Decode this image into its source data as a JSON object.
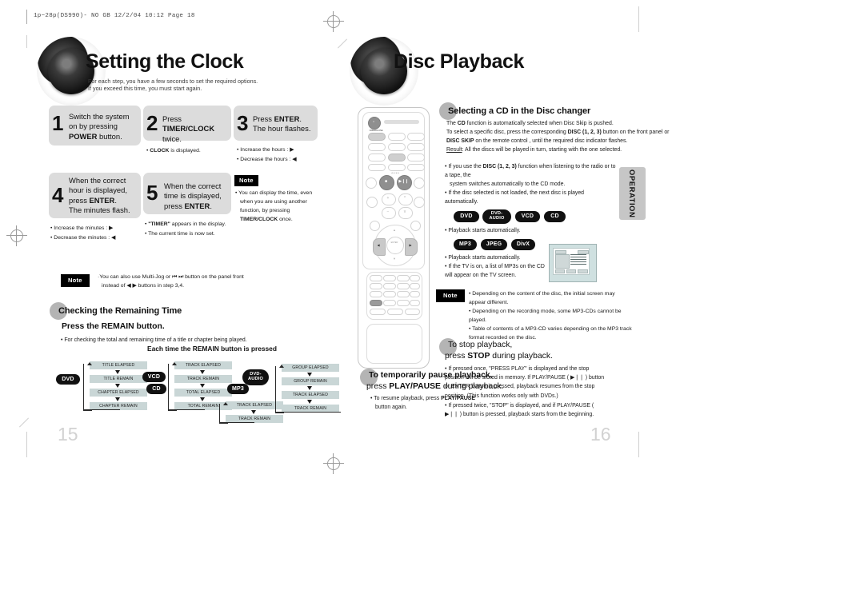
{
  "file_stamp": "1p~28p(DS990)- NO GB  12/2/04 10:12  Page 18",
  "left_page": {
    "chapter_title": "Setting the Clock",
    "chapter_sub_line1": "For each step, you have a few seconds to set the required options.",
    "chapter_sub_line2": "If you exceed this time, you must start again.",
    "steps": [
      {
        "num": "1",
        "line1": "Switch the system",
        "line2": "on by pressing",
        "line3_bold": "POWER",
        "line3_rest": " button.",
        "bullets": []
      },
      {
        "num": "2",
        "line1_pre": "Press ",
        "line1_bold": "TIMER/CLOCK",
        "line2": "twice.",
        "bullets": [
          "CLOCK is displayed."
        ]
      },
      {
        "num": "3",
        "line1_pre": "Press ",
        "line1_bold": "ENTER",
        "line1_post": ".",
        "line2": "The hour flashes.",
        "bullets": [
          "Increase the hours :  ▶",
          "Decrease the hours :  ◀"
        ]
      },
      {
        "num": "4",
        "line1": "When the correct",
        "line2": "hour is displayed,",
        "line3_pre": "press ",
        "line3_bold": "ENTER",
        "line3_post": ".",
        "line4": "The minutes flash.",
        "bullets": [
          "Increase the minutes :  ▶",
          "Decrease the minutes :  ◀"
        ]
      },
      {
        "num": "5",
        "line1": "When the correct",
        "line2": "time is displayed,",
        "line3_pre": "press ",
        "line3_bold": "ENTER",
        "line3_post": ".",
        "bullets": [
          "\"TIMER\" appears in the display.",
          "The current time is now set."
        ]
      }
    ],
    "step_note": {
      "label": "Note",
      "line1": "You can display the time, even",
      "line2": "when you are using another",
      "line3": "function, by pressing",
      "line4_bold": "TIMER/CLOCK",
      "line4_rest": " once."
    },
    "multijog_note": {
      "label": "Note",
      "line1": "·You can also  use Multi-Jog or ⏮ ⏭ button on  the panel front",
      "line2": "instead of ◀  ▶  buttons in step 3,4."
    },
    "remaining": {
      "section_title": "Checking the Remaining Time",
      "subhead": "Press the REMAIN button.",
      "bullet": "For checking the total and remaining time of a title or chapter being played.",
      "center_head": "Each time the REMAIN button is pressed"
    },
    "flows": [
      {
        "badges": [
          "DVD"
        ],
        "cells": [
          "TITLE ELAPSED",
          "TITLE REMAIN",
          "CHAPTER ELAPSED",
          "CHAPTER REMAIN"
        ]
      },
      {
        "badges": [
          "VCD",
          "CD"
        ],
        "cells": [
          "TRACK ELAPSED",
          "TRACK REMAIN",
          "TOTAL ELAPSED",
          "TOTAL REMAIN"
        ]
      },
      {
        "badges": [
          "MP3"
        ],
        "cells": [
          "TRACK ELAPSED",
          "TRACK REMAIN"
        ]
      },
      {
        "badges": [
          "DVD-AUDIO"
        ],
        "cells": [
          "GROUP ELAPSED",
          "GROUP REMAIN",
          "TRACK ELAPSED",
          "TRACK REMAIN"
        ]
      }
    ],
    "page_number": "15"
  },
  "right_page": {
    "chapter_title": "Disc Playback",
    "section_title": "Selecting a CD in the Disc changer",
    "para": [
      {
        "pre": "The ",
        "b1": "CD",
        "post": " function is automatically selected when Disc Skip is pushed."
      },
      {
        "pre": "To select a specific disc, press the corresponding ",
        "b1": "DISC (1, 2, 3)",
        "post": " button on the front panel or"
      },
      {
        "b1": "DISC SKIP",
        "post": " on the remote control , until the required disc indicator flashes."
      },
      {
        "u": "Result",
        "post": ": All the discs will be played in turn, starting with the one selected."
      }
    ],
    "bullets_top": [
      {
        "pre": "If you use the ",
        "b1": "DISC (1, 2, 3)",
        "post": " function when listening to the radio or to a tape, the"
      },
      {
        "cont": "system switches automatically to the CD mode."
      },
      {
        "pre": "If the disc selected is not loaded, the next disc is played automatically."
      }
    ],
    "badge_row_1": [
      "DVD",
      "DVD-AUDIO",
      "VCD",
      "CD"
    ],
    "badge_row_1_bullets": [
      "Playback starts automatically."
    ],
    "badge_row_2": [
      "MP3",
      "JPEG",
      "DivX"
    ],
    "badge_row_2_bullets": [
      "Playback starts automatically.",
      "If the TV is on, a list of MP3s on the CD will appear on the TV screen."
    ],
    "note": {
      "label": "Note",
      "bullets": [
        "Depending on the content of the disc, the initial screen may appear different.",
        "Depending on the recording mode, some MP3-CDs cannot be played.",
        "Table of contents of a MP3-CD varies depending on the MP3 track format recorded on the disc."
      ]
    },
    "pause_section": {
      "line1": "To temporarily pause playback,",
      "line2_pre": "press ",
      "line2_bold": "PLAY/PAUSE",
      "line2_post": " during playback.",
      "bullet_pre": "To resume playback, press ",
      "bullet_bold": "PLAY/PAUSE",
      "bullet_post": "",
      "bullet_line2": "button again."
    },
    "stop_section": {
      "line1": "To stop playback,",
      "line2_pre": "press ",
      "line2_bold": "STOP",
      "line2_post": " during playback.",
      "bullets": [
        "If pressed once, \"PRESS PLAY\" is displayed and the stop position will be stored in memory. If PLAY/PAUSE ( ▶❘❘ ) button or ENTER button is pressed, playback resumes from the stop position. (This function works only with DVDs.)",
        "If pressed twice, \"STOP\" is displayed, and if PLAY/PAUSE ( ▶❘❘ ) button is pressed, playback starts from the beginning."
      ]
    },
    "side_tab": "OPERATION",
    "page_number": "16",
    "remote": {
      "power_label": "⏻",
      "open_close": "OPEN/CLOSE",
      "stop_label": "■",
      "play_pause_label": "▶❘❘",
      "enter_label": "ENTER"
    }
  },
  "colors": {
    "step_box": "#dcdcdc",
    "flow_cell": "#c9d6d6",
    "badge": "#111111",
    "side_tab": "#c6c6c6",
    "page_number": "#d2d2d2"
  }
}
